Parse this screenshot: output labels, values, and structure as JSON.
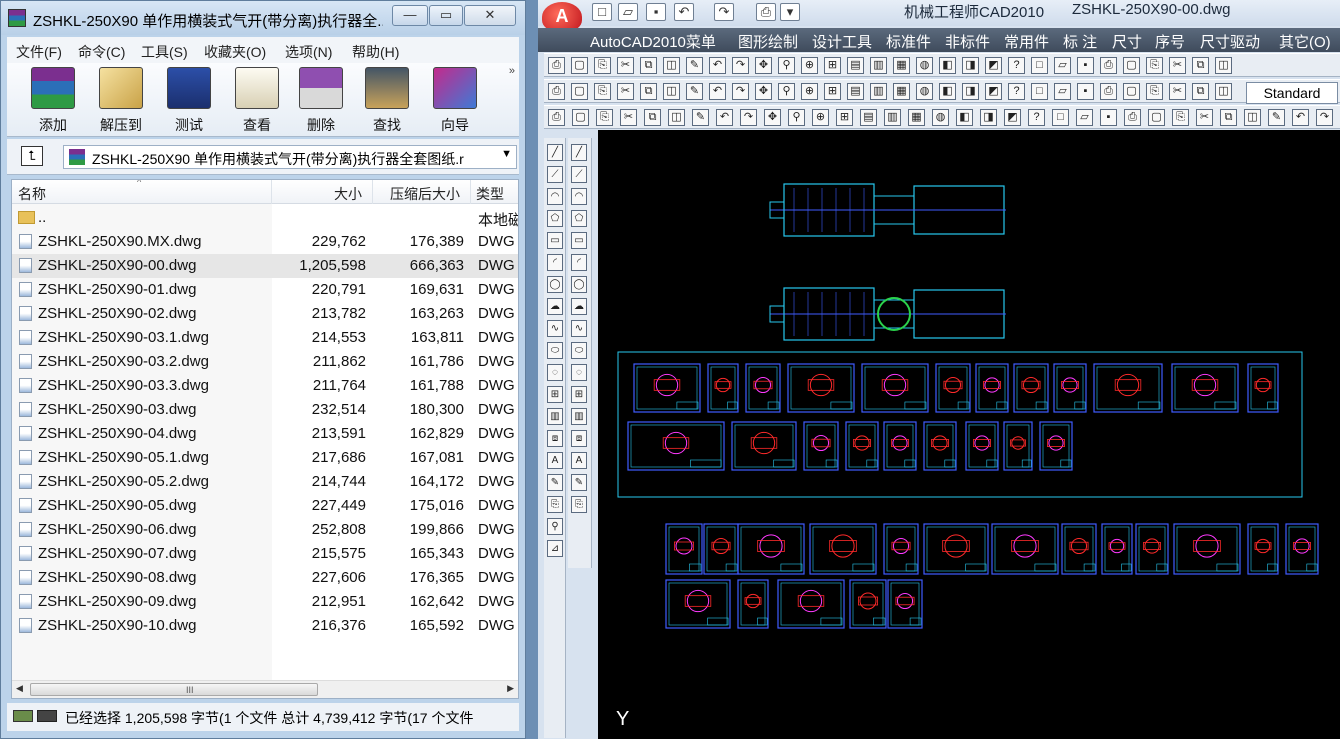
{
  "winrar": {
    "title": "ZSHKL-250X90 单作用横装式气开(带分离)执行器全...",
    "window_buttons": {
      "minimize": "—",
      "maximize": "▭",
      "close": "✕"
    },
    "menu": [
      "文件(F)",
      "命令(C)",
      "工具(S)",
      "收藏夹(O)",
      "选项(N)",
      "帮助(H)"
    ],
    "toolbar": {
      "items": [
        {
          "label": "添加",
          "icon": "add-archive-icon"
        },
        {
          "label": "解压到",
          "icon": "extract-to-icon"
        },
        {
          "label": "测试",
          "icon": "test-icon"
        },
        {
          "label": "查看",
          "icon": "view-icon"
        },
        {
          "label": "删除",
          "icon": "delete-icon"
        },
        {
          "label": "查找",
          "icon": "find-icon"
        },
        {
          "label": "向导",
          "icon": "wizard-icon"
        }
      ],
      "more": "»"
    },
    "path": {
      "up_label": "⮤",
      "text": "ZSHKL-250X90 单作用横装式气开(带分离)执行器全套图纸.r",
      "dropdown": "▼"
    },
    "columns": {
      "name": "名称",
      "size": "大小",
      "packed": "压缩后大小",
      "type": "类型"
    },
    "files": [
      {
        "name": "..",
        "size": "",
        "packed": "",
        "type": "本地磁",
        "folder": true
      },
      {
        "name": "ZSHKL-250X90.MX.dwg",
        "size": "229,762",
        "packed": "176,389",
        "type": "DWG"
      },
      {
        "name": "ZSHKL-250X90-00.dwg",
        "size": "1,205,598",
        "packed": "666,363",
        "type": "DWG",
        "selected": true
      },
      {
        "name": "ZSHKL-250X90-01.dwg",
        "size": "220,791",
        "packed": "169,631",
        "type": "DWG"
      },
      {
        "name": "ZSHKL-250X90-02.dwg",
        "size": "213,782",
        "packed": "163,263",
        "type": "DWG"
      },
      {
        "name": "ZSHKL-250X90-03.1.dwg",
        "size": "214,553",
        "packed": "163,811",
        "type": "DWG"
      },
      {
        "name": "ZSHKL-250X90-03.2.dwg",
        "size": "211,862",
        "packed": "161,786",
        "type": "DWG"
      },
      {
        "name": "ZSHKL-250X90-03.3.dwg",
        "size": "211,764",
        "packed": "161,788",
        "type": "DWG"
      },
      {
        "name": "ZSHKL-250X90-03.dwg",
        "size": "232,514",
        "packed": "180,300",
        "type": "DWG"
      },
      {
        "name": "ZSHKL-250X90-04.dwg",
        "size": "213,591",
        "packed": "162,829",
        "type": "DWG"
      },
      {
        "name": "ZSHKL-250X90-05.1.dwg",
        "size": "217,686",
        "packed": "167,081",
        "type": "DWG"
      },
      {
        "name": "ZSHKL-250X90-05.2.dwg",
        "size": "214,744",
        "packed": "164,172",
        "type": "DWG"
      },
      {
        "name": "ZSHKL-250X90-05.dwg",
        "size": "227,449",
        "packed": "175,016",
        "type": "DWG"
      },
      {
        "name": "ZSHKL-250X90-06.dwg",
        "size": "252,808",
        "packed": "199,866",
        "type": "DWG"
      },
      {
        "name": "ZSHKL-250X90-07.dwg",
        "size": "215,575",
        "packed": "165,343",
        "type": "DWG"
      },
      {
        "name": "ZSHKL-250X90-08.dwg",
        "size": "227,606",
        "packed": "176,365",
        "type": "DWG"
      },
      {
        "name": "ZSHKL-250X90-09.dwg",
        "size": "212,951",
        "packed": "162,642",
        "type": "DWG"
      },
      {
        "name": "ZSHKL-250X90-10.dwg",
        "size": "216,376",
        "packed": "165,592",
        "type": "DWG"
      }
    ],
    "hscroll_grip": "III",
    "status": "已经选择 1,205,598 字节(1 个文件 总计 4,739,412 字节(17 个文件"
  },
  "autocad": {
    "logo": "A",
    "app_title": "机械工程师CAD2010",
    "file_name": "ZSHKL-250X90-00.dwg",
    "menu": [
      "AutoCAD2010菜单",
      "图形绘制",
      "设计工具",
      "标准件",
      "非标件",
      "常用件",
      "标 注",
      "尺寸",
      "序号",
      "尺寸驱动",
      "其它(O)"
    ],
    "text_style": "Standard",
    "ucs_label": "Y",
    "colors": {
      "canvas": "#000000",
      "drawing_cyan": "#27c7ee",
      "drawing_blue": "#3f5cff",
      "drawing_red": "#ff2a2a",
      "drawing_green": "#2bd24c",
      "drawing_magenta": "#ff39ff"
    }
  }
}
